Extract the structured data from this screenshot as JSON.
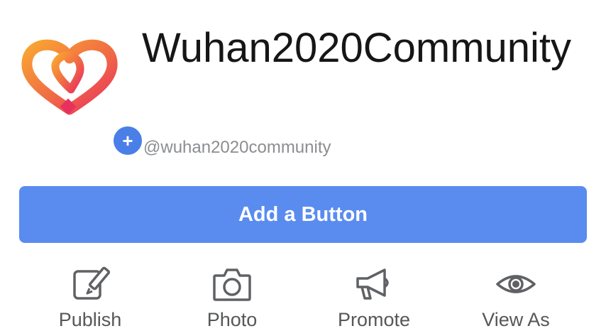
{
  "page": {
    "title": "Wuhan2020Community",
    "handle": "@wuhan2020community"
  },
  "avatar": {
    "icon": "heart-logo-icon",
    "badge_symbol": "+",
    "gradient_colors": [
      "#f7a534",
      "#e8345e"
    ]
  },
  "cta": {
    "label": "Add a Button",
    "color": "#5a8cf0"
  },
  "actions": [
    {
      "label": "Publish",
      "icon": "edit-icon"
    },
    {
      "label": "Photo",
      "icon": "camera-icon"
    },
    {
      "label": "Promote",
      "icon": "megaphone-icon"
    },
    {
      "label": "View As",
      "icon": "eye-icon"
    }
  ]
}
